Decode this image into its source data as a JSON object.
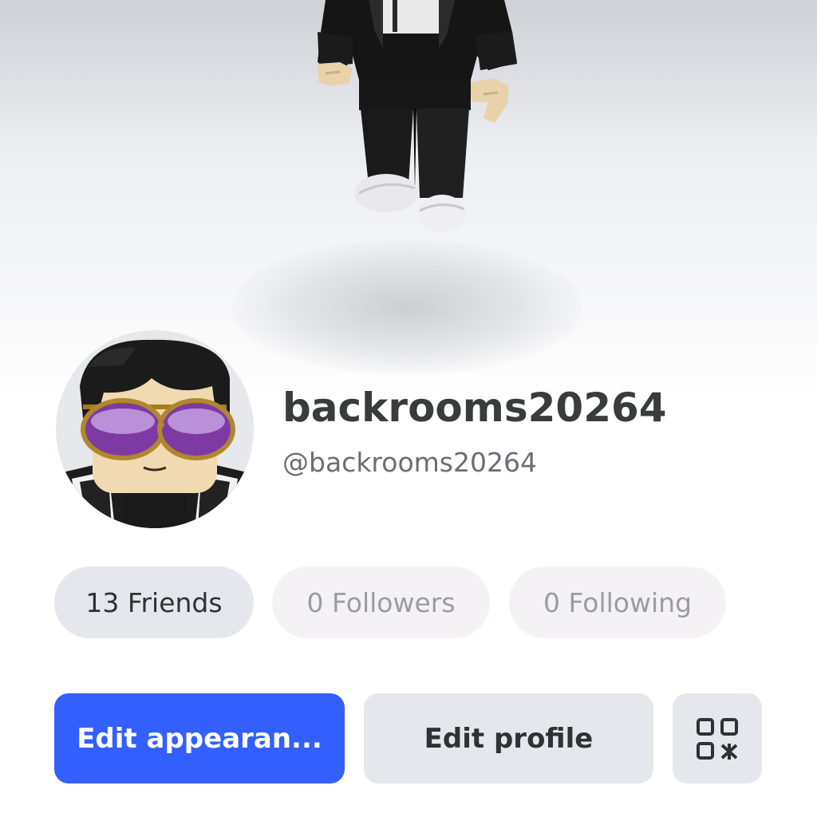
{
  "profile": {
    "display_name": "backrooms20264",
    "username": "@backrooms20264"
  },
  "stats": {
    "friends": "13 Friends",
    "followers": "0 Followers",
    "following": "0 Following"
  },
  "actions": {
    "edit_appearance": "Edit appearan...",
    "edit_profile": "Edit profile",
    "qr_icon": "qr-code-icon"
  },
  "colors": {
    "primary": "#335fff",
    "secondary_bg": "#e6e7ec",
    "muted_pill_bg": "#f4f2f5",
    "title_text": "#393b3d"
  }
}
